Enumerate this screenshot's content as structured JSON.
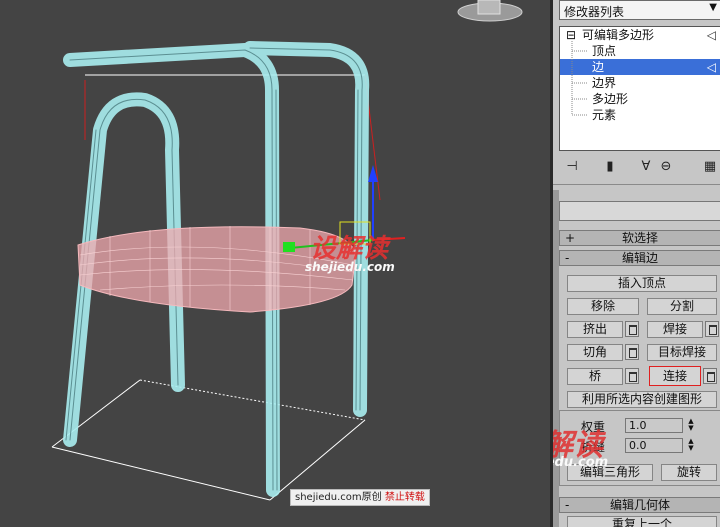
{
  "modifier_list": {
    "label": "修改器列表"
  },
  "stack": {
    "items": [
      {
        "label": "可编辑多边形",
        "prefix": "⊟",
        "selected": false
      },
      {
        "label": "顶点",
        "prefix": "",
        "selected": false
      },
      {
        "label": "边",
        "prefix": "",
        "selected": true
      },
      {
        "label": "边界",
        "prefix": "",
        "selected": false
      },
      {
        "label": "多边形",
        "prefix": "",
        "selected": false
      },
      {
        "label": "元素",
        "prefix": "",
        "selected": false
      }
    ]
  },
  "soft_selection": {
    "sign": "+",
    "title": "软选择"
  },
  "edit_edges": {
    "sign": "-",
    "title": "编辑边",
    "insert_vertex": "插入顶点",
    "remove": "移除",
    "split": "分割",
    "extrude": "挤出",
    "weld": "焊接",
    "chamfer": "切角",
    "target_weld": "目标焊接",
    "bridge": "桥",
    "connect": "连接",
    "create_shape": "利用所选内容创建图形",
    "weight_label": "权重",
    "weight_value": "1.0",
    "crease_label": "折缝",
    "crease_value": "0.0",
    "edit_triangulation": "编辑三角形",
    "turn": "旋转"
  },
  "edit_geometry": {
    "sign": "-",
    "title": "编辑几何体",
    "repeat_last": "重复上一个"
  },
  "watermarks": {
    "logo": "设解读",
    "url": "shejiedu.com"
  },
  "credit": {
    "site": "shejiedu.com",
    "original": "原创",
    "warning": "禁止转载"
  }
}
